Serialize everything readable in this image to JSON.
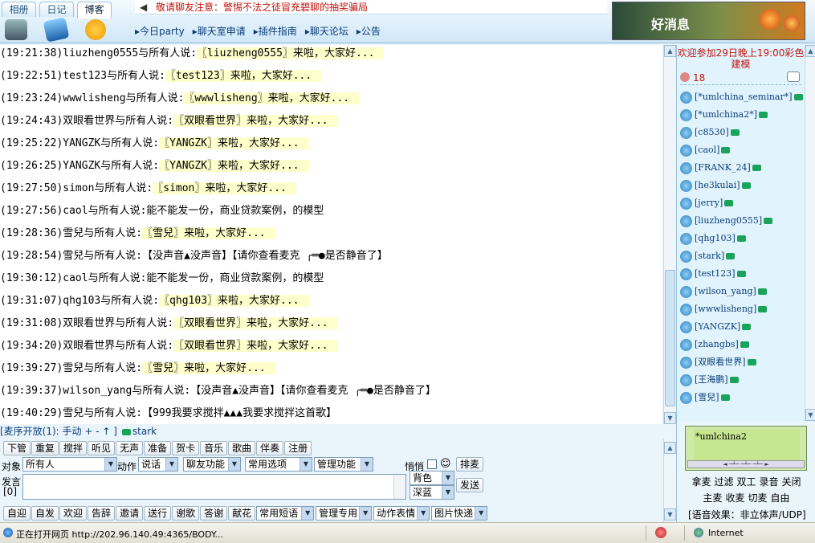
{
  "top": {
    "tabs": [
      "相册",
      "日记",
      "博客"
    ],
    "notice": "敬请聊友注意：警惕不法之徒冒充碧聊的抽奖骗局",
    "nav_links": [
      "▸今日party",
      "▸聊天室申请",
      "▸插件指南",
      "▸聊天论坛",
      "▸公告"
    ],
    "banner_text": "好消息"
  },
  "chat": {
    "messages": [
      {
        "time": "(19:21:38)",
        "speaker": "liuzheng0555",
        "verb": "与所有人说:",
        "body": "〖liuzheng0555〗来啦，大家好...",
        "highlight": true
      },
      {
        "time": "(19:22:51)",
        "speaker": "test123",
        "verb": "与所有人说:",
        "body": "〖test123〗来啦，大家好...",
        "highlight": true
      },
      {
        "time": "(19:23:24)",
        "speaker": "wwwlisheng",
        "verb": "与所有人说:",
        "body": "〖wwwlisheng〗来啦，大家好...",
        "highlight": true
      },
      {
        "time": "(19:24:43)",
        "speaker": "双眼看世界",
        "verb": "与所有人说:",
        "body": "〖双眼看世界〗来啦，大家好...",
        "highlight": true
      },
      {
        "time": "(19:25:22)",
        "speaker": "YANGZK",
        "verb": "与所有人说:",
        "body": "〖YANGZK〗来啦，大家好...",
        "highlight": true
      },
      {
        "time": "(19:26:25)",
        "speaker": "YANGZK",
        "verb": "与所有人说:",
        "body": "〖YANGZK〗来啦，大家好...",
        "highlight": true
      },
      {
        "time": "(19:27:50)",
        "speaker": "simon",
        "verb": "与所有人说:",
        "body": "〖simon〗来啦，大家好...",
        "highlight": true
      },
      {
        "time": "(19:27:56)",
        "speaker": "caol",
        "verb": "与所有人说:",
        "body": "能不能发一份，商业贷款案例，的模型",
        "highlight": false
      },
      {
        "time": "(19:28:36)",
        "speaker": "雪兒",
        "verb": "与所有人说:",
        "body": "〖雪兒〗来啦，大家好...",
        "highlight": true
      },
      {
        "time": "(19:28:54)",
        "speaker": "雪兒",
        "verb": "与所有人说:",
        "body": "【没声音▲没声音】【请你查看麦克 ╭═●是否静音了】",
        "highlight": false
      },
      {
        "time": "(19:30:12)",
        "speaker": "caol",
        "verb": "与所有人说:",
        "body": "能不能发一份，商业贷款案例，的模型",
        "highlight": false
      },
      {
        "time": "(19:31:07)",
        "speaker": "qhg103",
        "verb": "与所有人说:",
        "body": "〖qhg103〗来啦，大家好...",
        "highlight": true
      },
      {
        "time": "(19:31:08)",
        "speaker": "双眼看世界",
        "verb": "与所有人说:",
        "body": "〖双眼看世界〗来啦，大家好...",
        "highlight": true
      },
      {
        "time": "(19:34:20)",
        "speaker": "双眼看世界",
        "verb": "与所有人说:",
        "body": "〖双眼看世界〗来啦，大家好...",
        "highlight": true
      },
      {
        "time": "(19:39:27)",
        "speaker": "雪兒",
        "verb": "与所有人说:",
        "body": "〖雪兒〗来啦，大家好...",
        "highlight": true
      },
      {
        "time": "(19:39:37)",
        "speaker": "wilson_yang",
        "verb": "与所有人说:",
        "body": "【没声音▲没声音】【请你查看麦克 ╭═●是否静音了】",
        "highlight": false
      },
      {
        "time": "(19:40:29)",
        "speaker": "雪兒",
        "verb": "与所有人说:",
        "body": "【999我要求搅拌▲▲▲我要求搅拌这首歌】",
        "highlight": false
      }
    ]
  },
  "mic": {
    "label": "[麦序开放(1): 手动 + - ↑ ]",
    "user": "stark"
  },
  "side": {
    "welcome": "欢迎参加29日晚上19:00彩色建模",
    "count": "18",
    "users": [
      "[*umlchina_seminar*]",
      "[*umlchina2*]",
      "[c8530]",
      "[caol]",
      "[FRANK_24]",
      "[he3kulai]",
      "[jerry]",
      "[liuzheng0555]",
      "[qhg103]",
      "[stark]",
      "[test123]",
      "[wilson_yang]",
      "[wwwlisheng]",
      "[YANGZK]",
      "[zhangbs]",
      "[双眼看世界]",
      "[王海鹏]",
      "[雪兒]"
    ]
  },
  "controls": {
    "row1": [
      "下管",
      "重复",
      "搅拌",
      "听见",
      "无声",
      "准备",
      "贺卡",
      "音乐",
      "歌曲",
      "伴奏",
      "注册"
    ],
    "target_label": "对象",
    "target_value": "所有人",
    "action_label": "动作",
    "action_value": "说话",
    "menu1": "聊友功能",
    "menu2": "常用选项",
    "menu3": "管理功能",
    "quiet_label": "悄悄",
    "smiley": "☺",
    "queue_button": "排麦",
    "speak_label": "发言",
    "speak_count": "[0]",
    "bg_color": "背色",
    "text_color": "深蓝",
    "send_button": "发送",
    "row3": [
      "自迎",
      "自发",
      "欢迎",
      "告辞",
      "邀请",
      "送行",
      "谢歌",
      "答谢",
      "献花"
    ],
    "menu4": "常用短语",
    "menu5": "管理专用",
    "menu6": "动作表情",
    "menu7": "图片快递"
  },
  "voice": {
    "current": "*umlchina2",
    "row1": [
      "拿麦",
      "过滤",
      "双工",
      "录音",
      "关闭"
    ],
    "row2": [
      "主麦",
      "收麦",
      "切麦",
      "自由"
    ],
    "effect": "[语音效果：非立体声/UDP]"
  },
  "status": {
    "text": "正在打开网页 http://202.96.140.49:4365/BODY...",
    "zone": "Internet"
  }
}
